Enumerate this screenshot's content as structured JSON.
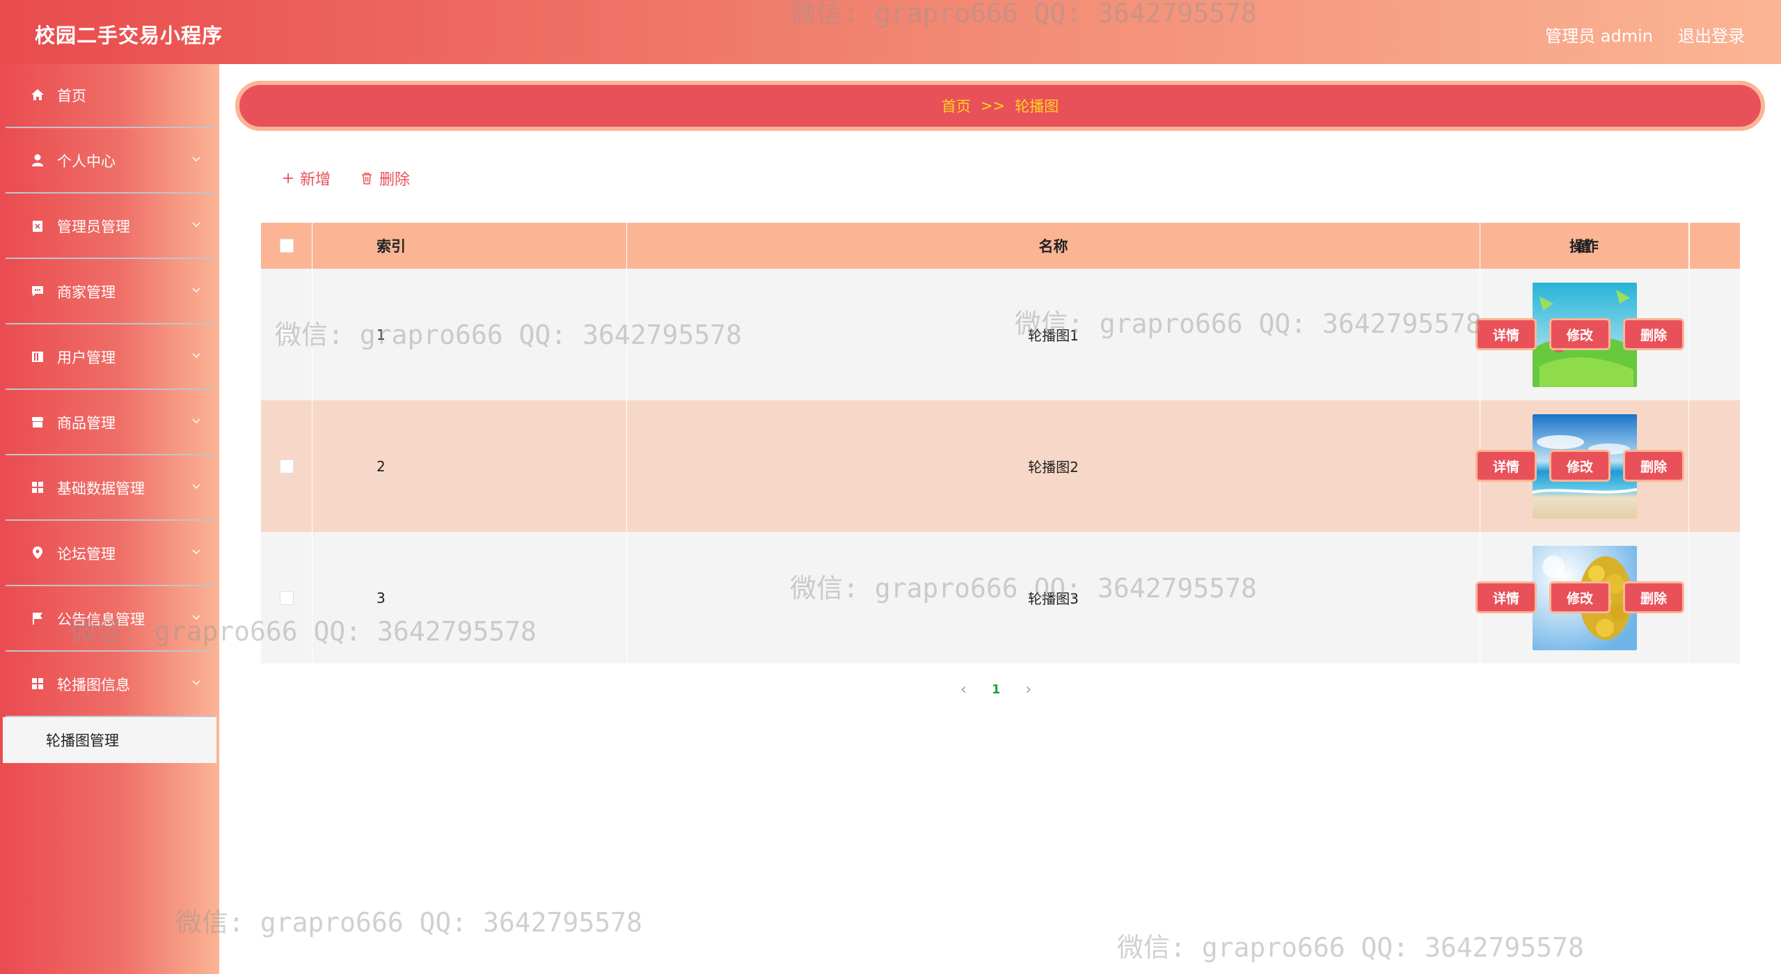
{
  "header": {
    "app_title": "校园二手交易小程序",
    "admin_label": "管理员 admin",
    "logout_label": "退出登录"
  },
  "sidebar": {
    "items": [
      {
        "label": "首页",
        "icon": "home-icon"
      },
      {
        "label": "个人中心",
        "icon": "user-icon"
      },
      {
        "label": "管理员管理",
        "icon": "clipboard-icon"
      },
      {
        "label": "商家管理",
        "icon": "chat-icon"
      },
      {
        "label": "用户管理",
        "icon": "book-icon"
      },
      {
        "label": "商品管理",
        "icon": "store-icon"
      },
      {
        "label": "基础数据管理",
        "icon": "grid-icon"
      },
      {
        "label": "论坛管理",
        "icon": "location-pin-icon"
      },
      {
        "label": "公告信息管理",
        "icon": "flag-icon"
      },
      {
        "label": "轮播图信息",
        "icon": "grid-icon"
      }
    ],
    "active_sub": "轮播图管理"
  },
  "breadcrumb": {
    "home": "首页",
    "separator": ">>",
    "current": "轮播图"
  },
  "toolbar": {
    "add_label": "新增",
    "delete_label": "删除"
  },
  "table": {
    "headers": {
      "index": "索引",
      "name": "名称",
      "value": "值",
      "ops": "操作"
    },
    "rows": [
      {
        "index": "1",
        "name": "轮播图1",
        "image": "meadow-children-image"
      },
      {
        "index": "2",
        "name": "轮播图2",
        "image": "beach-sea-image"
      },
      {
        "index": "3",
        "name": "轮播图3",
        "image": "yellow-flowers-image"
      }
    ],
    "ops": {
      "detail": "详情",
      "edit": "修改",
      "delete": "删除"
    }
  },
  "pagination": {
    "current": "1"
  },
  "watermark": "微信: grapro666 QQ: 3642795578",
  "colors": {
    "primary": "#e9515a",
    "accent": "#fbb595",
    "breadcrumb_text": "#ffd21e"
  }
}
